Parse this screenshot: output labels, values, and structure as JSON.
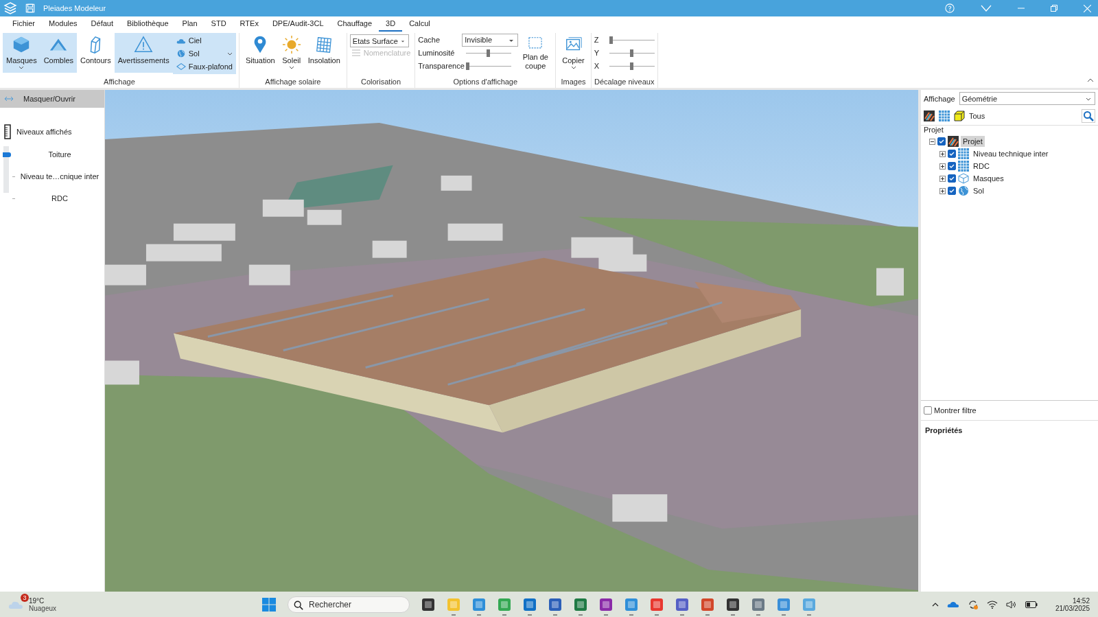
{
  "window": {
    "title": "Pleiades Modeleur"
  },
  "menu": [
    {
      "label": "Fichier",
      "selected": false
    },
    {
      "label": "Modules",
      "selected": false
    },
    {
      "label": "Défaut",
      "selected": false
    },
    {
      "label": "Bibliothèque",
      "selected": false
    },
    {
      "label": "Plan",
      "selected": false
    },
    {
      "label": "STD",
      "selected": false
    },
    {
      "label": "RTEx",
      "selected": false
    },
    {
      "label": "DPE/Audit-3CL",
      "selected": false
    },
    {
      "label": "Chauffage",
      "selected": false
    },
    {
      "label": "3D",
      "selected": true
    },
    {
      "label": "Calcul",
      "selected": false
    }
  ],
  "ribbon": {
    "display": {
      "label": "Affichage",
      "buttons": [
        {
          "label": "Masques",
          "kind": "masks",
          "selected": true,
          "dropdown": true
        },
        {
          "label": "Combles",
          "kind": "roof",
          "selected": true,
          "dropdown": false
        },
        {
          "label": "Contours",
          "kind": "contours",
          "selected": false,
          "dropdown": false
        },
        {
          "label": "Avertissements",
          "kind": "warning",
          "selected": true,
          "dropdown": false
        }
      ],
      "options": [
        {
          "label": "Ciel",
          "kind": "cloud",
          "dropdown": false
        },
        {
          "label": "Sol",
          "kind": "globe",
          "dropdown": true
        },
        {
          "label": "Faux-plafond",
          "kind": "diamond",
          "dropdown": false
        }
      ],
      "options_selected": true
    },
    "solar": {
      "label": "Affichage solaire",
      "buttons": [
        {
          "label": "Situation",
          "kind": "pin",
          "selected": false,
          "dropdown": false
        },
        {
          "label": "Soleil",
          "kind": "sun",
          "selected": false,
          "dropdown": true
        },
        {
          "label": "Insolation",
          "kind": "grid",
          "selected": false,
          "dropdown": false
        }
      ]
    },
    "colorisation": {
      "label": "Colorisation",
      "select": "Etats Surface",
      "nomenclature": {
        "label": "Nomenclature",
        "disabled": true
      }
    },
    "display_options": {
      "label": "Options d'affichage",
      "cache": {
        "label": "Cache",
        "value": "Invisible"
      },
      "sliders": [
        {
          "label": "Luminosité",
          "level": 0.48
        },
        {
          "label": "Transparence",
          "level": 0
        }
      ],
      "cut_plane": "Plan de coupe"
    },
    "images": {
      "label": "Images",
      "copy": "Copier"
    },
    "level_offset": {
      "label": "Décalage niveaux",
      "sliders": [
        {
          "label": "Z",
          "level": 0
        },
        {
          "label": "Y",
          "level": 0.5
        },
        {
          "label": "X",
          "level": 0.5
        }
      ]
    }
  },
  "left_panel": {
    "toggle": "Masquer/Ouvrir",
    "title": "Niveaux affichés",
    "levels": [
      {
        "label": "Toiture",
        "selected": true
      },
      {
        "label": "Niveau te…cnique inter",
        "selected": false
      },
      {
        "label": "RDC",
        "selected": false
      }
    ]
  },
  "right_panel": {
    "display": {
      "label": "Affichage",
      "value": "Géométrie"
    },
    "filter_label": "Tous",
    "group": "Projet",
    "tree": [
      {
        "label": "Projet",
        "kind": "project",
        "checked": true,
        "expanded": true,
        "selected": true,
        "children": [
          {
            "label": "Niveau technique inter",
            "kind": "level",
            "checked": true,
            "expanded": false,
            "selected": false
          },
          {
            "label": "RDC",
            "kind": "level",
            "checked": true,
            "expanded": false,
            "selected": false
          },
          {
            "label": "Masques",
            "kind": "masks",
            "checked": true,
            "expanded": false,
            "selected": false
          },
          {
            "label": "Sol",
            "kind": "globe",
            "checked": true,
            "expanded": false,
            "selected": false
          }
        ]
      }
    ],
    "show_filter": {
      "label": "Montrer filtre",
      "checked": false
    },
    "properties": "Propriétés"
  },
  "taskbar": {
    "weather": {
      "badge": "3",
      "temperature": "19°C",
      "condition": "Nuageux"
    },
    "search": {
      "placeholder": "Rechercher"
    },
    "time": "14:52",
    "date": "21/03/2025"
  }
}
